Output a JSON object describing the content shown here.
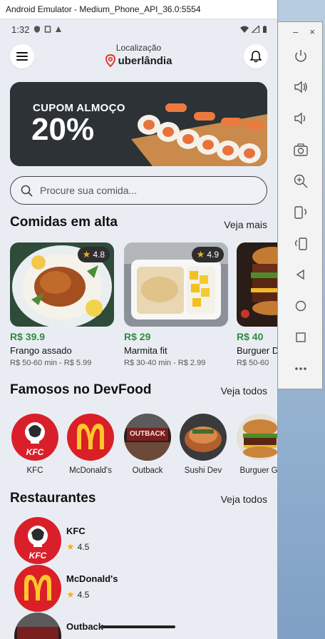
{
  "emulator": {
    "title": "Android Emulator - Medium_Phone_API_36.0:5554",
    "toolbar": {
      "minimize": "–",
      "close": "×",
      "buttons": [
        "power-icon",
        "volume-up-icon",
        "volume-down-icon",
        "camera-icon",
        "zoom-icon",
        "rotate-left-icon",
        "rotate-right-icon",
        "back-icon",
        "home-icon",
        "overview-icon",
        "more-icon"
      ]
    }
  },
  "status_bar": {
    "time": "1:32"
  },
  "header": {
    "location_label": "Localização",
    "city": "uberlândia"
  },
  "banner": {
    "subtitle": "CUPOM ALMOÇO",
    "discount": "20%"
  },
  "search": {
    "placeholder": "Procure sua comida..."
  },
  "trending": {
    "title": "Comidas em alta",
    "link": "Veja mais",
    "items": [
      {
        "rating": "4.8",
        "price": "R$ 39.9",
        "name": "Frango assado",
        "meta": "R$ 50-60 min - R$ 5.99"
      },
      {
        "rating": "4.9",
        "price": "R$ 29",
        "name": "Marmita fit",
        "meta": "R$ 30-40 min - R$ 2.99"
      },
      {
        "price": "R$ 40",
        "name": "Burguer D",
        "meta": "R$ 50-60"
      }
    ]
  },
  "famous": {
    "title": "Famosos no DevFood",
    "link": "Veja todos",
    "brands": [
      {
        "name": "KFC"
      },
      {
        "name": "McDonald's"
      },
      {
        "name": "Outback"
      },
      {
        "name": "Sushi Dev"
      },
      {
        "name": "Burguer Gr"
      }
    ]
  },
  "restaurants": {
    "title": "Restaurantes",
    "link": "Veja todos",
    "items": [
      {
        "name": "KFC",
        "rating": "4.5"
      },
      {
        "name": "McDonald's",
        "rating": "4.5"
      },
      {
        "name": "Outback"
      }
    ]
  },
  "logo_text": {
    "kfc": "KFC",
    "outback": "OUTBACK"
  },
  "colors": {
    "price_green": "#2e8b3d",
    "star": "#f2b01e",
    "pin_red": "#e53935",
    "mcd_red": "#da1f26",
    "mcd_yellow": "#ffc72c"
  }
}
